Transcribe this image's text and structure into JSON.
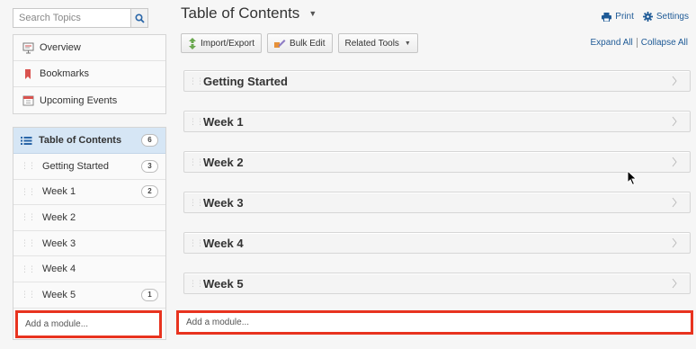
{
  "search": {
    "placeholder": "Search Topics"
  },
  "nav": {
    "items": [
      {
        "label": "Overview",
        "icon": "overview-icon"
      },
      {
        "label": "Bookmarks",
        "icon": "bookmark-icon"
      },
      {
        "label": "Upcoming Events",
        "icon": "calendar-icon"
      }
    ]
  },
  "toc_nav": {
    "header": {
      "label": "Table of Contents",
      "count": "6"
    },
    "items": [
      {
        "label": "Getting Started",
        "count": "3"
      },
      {
        "label": "Week 1",
        "count": "2"
      },
      {
        "label": "Week 2",
        "count": ""
      },
      {
        "label": "Week 3",
        "count": ""
      },
      {
        "label": "Week 4",
        "count": ""
      },
      {
        "label": "Week 5",
        "count": "1"
      }
    ],
    "add_placeholder": "Add a module..."
  },
  "main": {
    "title": "Table of Contents",
    "print_label": "Print",
    "settings_label": "Settings",
    "toolbar": {
      "import_export": "Import/Export",
      "bulk_edit": "Bulk Edit",
      "related_tools": "Related Tools"
    },
    "expand_all": "Expand All",
    "collapse_all": "Collapse All",
    "modules": [
      {
        "title": "Getting Started"
      },
      {
        "title": "Week 1"
      },
      {
        "title": "Week 2"
      },
      {
        "title": "Week 3"
      },
      {
        "title": "Week 4"
      },
      {
        "title": "Week 5"
      }
    ],
    "add_placeholder": "Add a module..."
  },
  "colors": {
    "link": "#1e5a96",
    "highlight_border": "#e8331f",
    "toc_header_bg": "#d6e6f5"
  }
}
